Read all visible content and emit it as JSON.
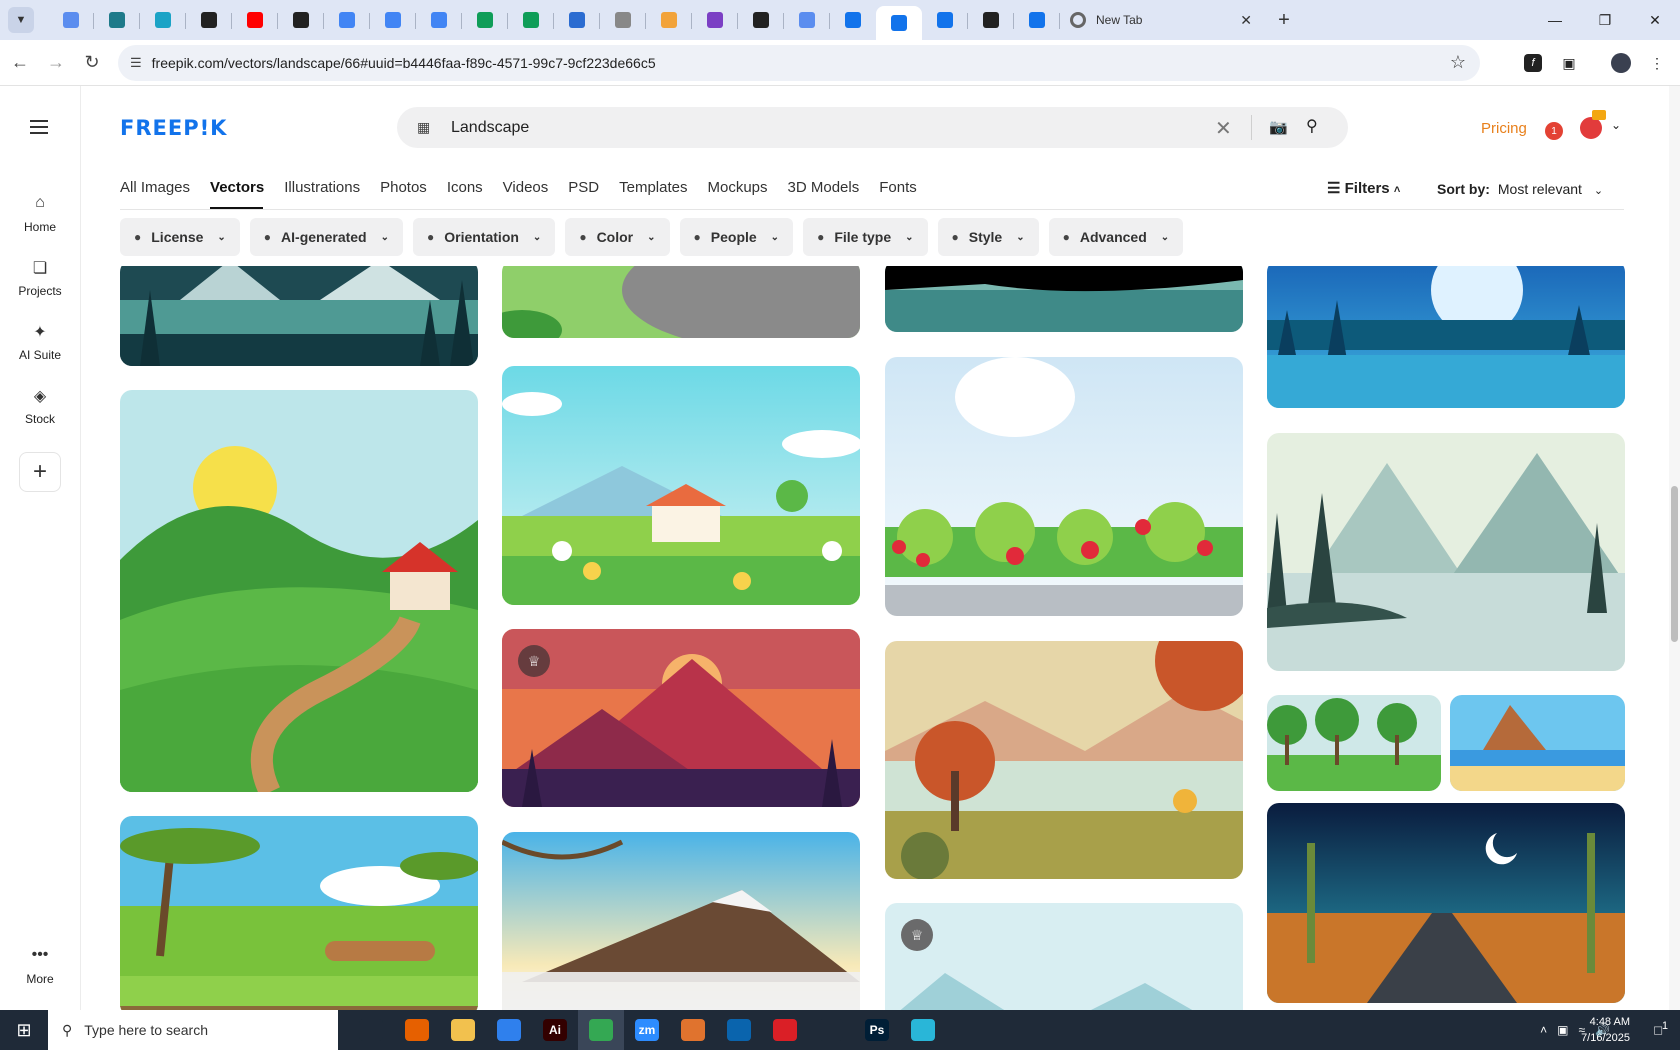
{
  "browser": {
    "tabs": [
      {
        "icon": "globe-half-icon",
        "color": "#5b8def"
      },
      {
        "icon": "v-shield-icon",
        "color": "#1e7a8a"
      },
      {
        "icon": "arrow-badge-icon",
        "color": "#1ba3c6"
      },
      {
        "icon": "openai-icon",
        "color": "#222222"
      },
      {
        "icon": "youtube-icon",
        "color": "#ff0000"
      },
      {
        "icon": "bolt-icon",
        "color": "#222222"
      },
      {
        "icon": "docs-icon",
        "color": "#4285f4"
      },
      {
        "icon": "docs-icon",
        "color": "#4285f4"
      },
      {
        "icon": "docs-icon",
        "color": "#4285f4"
      },
      {
        "icon": "sheets-icon",
        "color": "#0f9d58"
      },
      {
        "icon": "sheets-icon",
        "color": "#0f9d58"
      },
      {
        "icon": "calendar-icon",
        "color": "#2b6cd1"
      },
      {
        "icon": "globe-icon",
        "color": "#888888"
      },
      {
        "icon": "heart-icon",
        "color": "#f2a33a"
      },
      {
        "icon": "braces-icon",
        "color": "#7b3fc4"
      },
      {
        "icon": "a-icon",
        "color": "#222222"
      },
      {
        "icon": "grid-icon",
        "color": "#5b8def"
      },
      {
        "icon": "freepik-icon",
        "color": "#1273eb"
      },
      {
        "icon": "freepik-icon",
        "color": "#1273eb"
      },
      {
        "icon": "freepik-icon",
        "color": "#1273eb"
      },
      {
        "icon": "m-icon",
        "color": "#222222"
      },
      {
        "icon": "freepik-icon",
        "color": "#1273eb"
      }
    ],
    "new_tab_label": "New Tab",
    "url": "freepik.com/vectors/landscape/66#uuid=b4446faa-f89c-4571-99c7-9cf223de66c5"
  },
  "site": {
    "logo": "FREEP!K",
    "search_value": "Landscape",
    "pricing": "Pricing",
    "notification_count": "1",
    "sidebar": [
      {
        "label": "Home",
        "icon": "home-icon"
      },
      {
        "label": "Projects",
        "icon": "projects-icon"
      },
      {
        "label": "AI Suite",
        "icon": "sparkles-icon"
      },
      {
        "label": "Stock",
        "icon": "stock-icon"
      }
    ],
    "more_label": "More",
    "categories": [
      "All Images",
      "Vectors",
      "Illustrations",
      "Photos",
      "Icons",
      "Videos",
      "PSD",
      "Templates",
      "Mockups",
      "3D Models",
      "Fonts"
    ],
    "active_category": "Vectors",
    "filters_label": "Filters",
    "sort_label": "Sort by:",
    "sort_value": "Most relevant",
    "chips": [
      {
        "label": "License",
        "icon": "license-icon"
      },
      {
        "label": "AI-generated",
        "icon": "ai-icon"
      },
      {
        "label": "Orientation",
        "icon": "orientation-icon"
      },
      {
        "label": "Color",
        "icon": "palette-icon"
      },
      {
        "label": "People",
        "icon": "people-icon"
      },
      {
        "label": "File type",
        "icon": "file-icon"
      },
      {
        "label": "Style",
        "icon": "brush-icon"
      },
      {
        "label": "Advanced",
        "icon": "gear-icon"
      }
    ]
  },
  "taskbar": {
    "search_placeholder": "Type here to search",
    "time": "4:48 AM",
    "date": "7/16/2025",
    "notification_count": "1",
    "apps": [
      {
        "icon": "task-view-icon",
        "color": "#1f2a38"
      },
      {
        "icon": "firefox-icon",
        "color": "#e66000"
      },
      {
        "icon": "file-explorer-icon",
        "color": "#f2c14e"
      },
      {
        "icon": "vscode-icon",
        "color": "#2f80ed"
      },
      {
        "icon": "illustrator-icon",
        "color": "#330000",
        "text": "Ai"
      },
      {
        "icon": "chrome-icon",
        "color": "#34a853"
      },
      {
        "icon": "zoom-icon",
        "color": "#2d8cff",
        "text": "zm"
      },
      {
        "icon": "box-icon",
        "color": "#e0732e"
      },
      {
        "icon": "outlook-icon",
        "color": "#0a64ad"
      },
      {
        "icon": "creative-cloud-icon",
        "color": "#da1f26"
      },
      {
        "icon": "pen-icon",
        "color": "#1f2a38"
      },
      {
        "icon": "photoshop-icon",
        "color": "#001e36",
        "text": "Ps"
      },
      {
        "icon": "app-icon",
        "color": "#29b6d8"
      }
    ]
  }
}
